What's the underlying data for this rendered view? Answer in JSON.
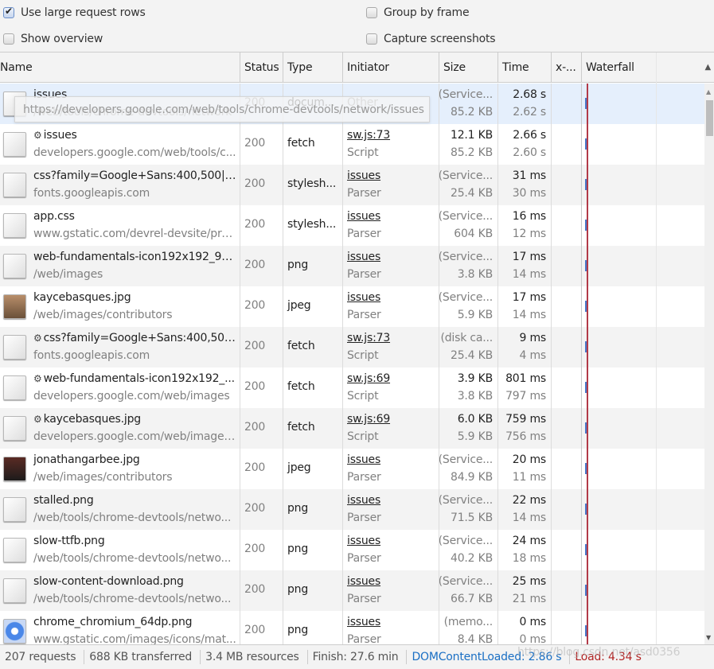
{
  "settings": {
    "use_large_rows": {
      "label": "Use large request rows",
      "checked": true
    },
    "show_overview": {
      "label": "Show overview",
      "checked": false
    },
    "group_by_frame": {
      "label": "Group by frame",
      "checked": false
    },
    "capture_screenshots": {
      "label": "Capture screenshots",
      "checked": false
    }
  },
  "columns": {
    "name": "Name",
    "status": "Status",
    "type": "Type",
    "initiator": "Initiator",
    "size": "Size",
    "time": "Time",
    "x": "x-...",
    "waterfall": "Waterfall",
    "sort_indicator": "▲"
  },
  "tooltip": "https://developers.google.com/web/tools/chrome-devtools/network/issues",
  "rows": [
    {
      "icon": "document",
      "name": "issues",
      "path": "/web/tools/chrome-devtools/network",
      "sw": false,
      "status": "200",
      "type": "docum...",
      "initiator": "Other",
      "initiator_sub": "",
      "size1": "(Service...",
      "size2": "85.2 KB",
      "time1": "2.68 s",
      "time2": "2.62 s"
    },
    {
      "icon": "blank",
      "name": "issues",
      "path": "developers.google.com/web/tools/c...",
      "sw": true,
      "status": "200",
      "type": "fetch",
      "initiator": "sw.js:73",
      "initiator_sub": "Script",
      "size1": "12.1 KB",
      "size2": "85.2 KB",
      "time1": "2.66 s",
      "time2": "2.60 s"
    },
    {
      "icon": "css",
      "name": "css?family=Google+Sans:400,500|Ro...",
      "path": "fonts.googleapis.com",
      "sw": false,
      "status": "200",
      "type": "stylesh...",
      "initiator": "issues",
      "initiator_sub": "Parser",
      "size1": "(Service...",
      "size2": "25.4 KB",
      "time1": "31 ms",
      "time2": "30 ms"
    },
    {
      "icon": "css",
      "name": "app.css",
      "path": "www.gstatic.com/devrel-devsite/pro...",
      "sw": false,
      "status": "200",
      "type": "stylesh...",
      "initiator": "issues",
      "initiator_sub": "Parser",
      "size1": "(Service...",
      "size2": "604 KB",
      "time1": "16 ms",
      "time2": "12 ms"
    },
    {
      "icon": "gear",
      "name": "web-fundamentals-icon192x192_96....",
      "path": "/web/images",
      "sw": false,
      "status": "200",
      "type": "png",
      "initiator": "issues",
      "initiator_sub": "Parser",
      "size1": "(Service...",
      "size2": "3.8 KB",
      "time1": "17 ms",
      "time2": "14 ms"
    },
    {
      "icon": "photo1",
      "name": "kaycebasques.jpg",
      "path": "/web/images/contributors",
      "sw": false,
      "status": "200",
      "type": "jpeg",
      "initiator": "issues",
      "initiator_sub": "Parser",
      "size1": "(Service...",
      "size2": "5.9 KB",
      "time1": "17 ms",
      "time2": "14 ms"
    },
    {
      "icon": "blank",
      "name": "css?family=Google+Sans:400,500|...",
      "path": "fonts.googleapis.com",
      "sw": true,
      "status": "200",
      "type": "fetch",
      "initiator": "sw.js:73",
      "initiator_sub": "Script",
      "size1": "(disk ca...",
      "size2": "25.4 KB",
      "time1": "9 ms",
      "time2": "4 ms"
    },
    {
      "icon": "blank",
      "name": "web-fundamentals-icon192x192_...",
      "path": "developers.google.com/web/images",
      "sw": true,
      "status": "200",
      "type": "fetch",
      "initiator": "sw.js:69",
      "initiator_sub": "Script",
      "size1": "3.9 KB",
      "size2": "3.8 KB",
      "time1": "801 ms",
      "time2": "797 ms"
    },
    {
      "icon": "blank",
      "name": "kaycebasques.jpg",
      "path": "developers.google.com/web/images...",
      "sw": true,
      "status": "200",
      "type": "fetch",
      "initiator": "sw.js:69",
      "initiator_sub": "Script",
      "size1": "6.0 KB",
      "size2": "5.9 KB",
      "time1": "759 ms",
      "time2": "756 ms"
    },
    {
      "icon": "photo2",
      "name": "jonathangarbee.jpg",
      "path": "/web/images/contributors",
      "sw": false,
      "status": "200",
      "type": "jpeg",
      "initiator": "issues",
      "initiator_sub": "Parser",
      "size1": "(Service...",
      "size2": "84.9 KB",
      "time1": "20 ms",
      "time2": "11 ms"
    },
    {
      "icon": "screenshot",
      "name": "stalled.png",
      "path": "/web/tools/chrome-devtools/netwo...",
      "sw": false,
      "status": "200",
      "type": "png",
      "initiator": "issues",
      "initiator_sub": "Parser",
      "size1": "(Service...",
      "size2": "71.5 KB",
      "time1": "22 ms",
      "time2": "14 ms"
    },
    {
      "icon": "screenshot",
      "name": "slow-ttfb.png",
      "path": "/web/tools/chrome-devtools/netwo...",
      "sw": false,
      "status": "200",
      "type": "png",
      "initiator": "issues",
      "initiator_sub": "Parser",
      "size1": "(Service...",
      "size2": "40.2 KB",
      "time1": "24 ms",
      "time2": "18 ms"
    },
    {
      "icon": "screenshot",
      "name": "slow-content-download.png",
      "path": "/web/tools/chrome-devtools/netwo...",
      "sw": false,
      "status": "200",
      "type": "png",
      "initiator": "issues",
      "initiator_sub": "Parser",
      "size1": "(Service...",
      "size2": "66.7 KB",
      "time1": "25 ms",
      "time2": "21 ms"
    },
    {
      "icon": "chrome",
      "name": "chrome_chromium_64dp.png",
      "path": "www.gstatic.com/images/icons/mat...",
      "sw": false,
      "status": "200",
      "type": "png",
      "initiator": "issues",
      "initiator_sub": "Parser",
      "size1": "(memo...",
      "size2": "8.4 KB",
      "time1": "0 ms",
      "time2": "0 ms"
    }
  ],
  "status_bar": {
    "requests": "207 requests",
    "transferred": "688 KB transferred",
    "resources": "3.4 MB resources",
    "finish": "Finish: 27.6 min",
    "dom_content_loaded": "DOMContentLoaded: 2.86 s",
    "load": "Load: 4.34 s"
  },
  "watermark": "https://blog.csdn.net/asd0356",
  "colors": {
    "dom_content_loaded": "#1a6fc4",
    "load": "#b22222",
    "selected_row": "#e5effc",
    "waterfall_bar": "#4a78c9",
    "load_line": "#b23a48"
  }
}
